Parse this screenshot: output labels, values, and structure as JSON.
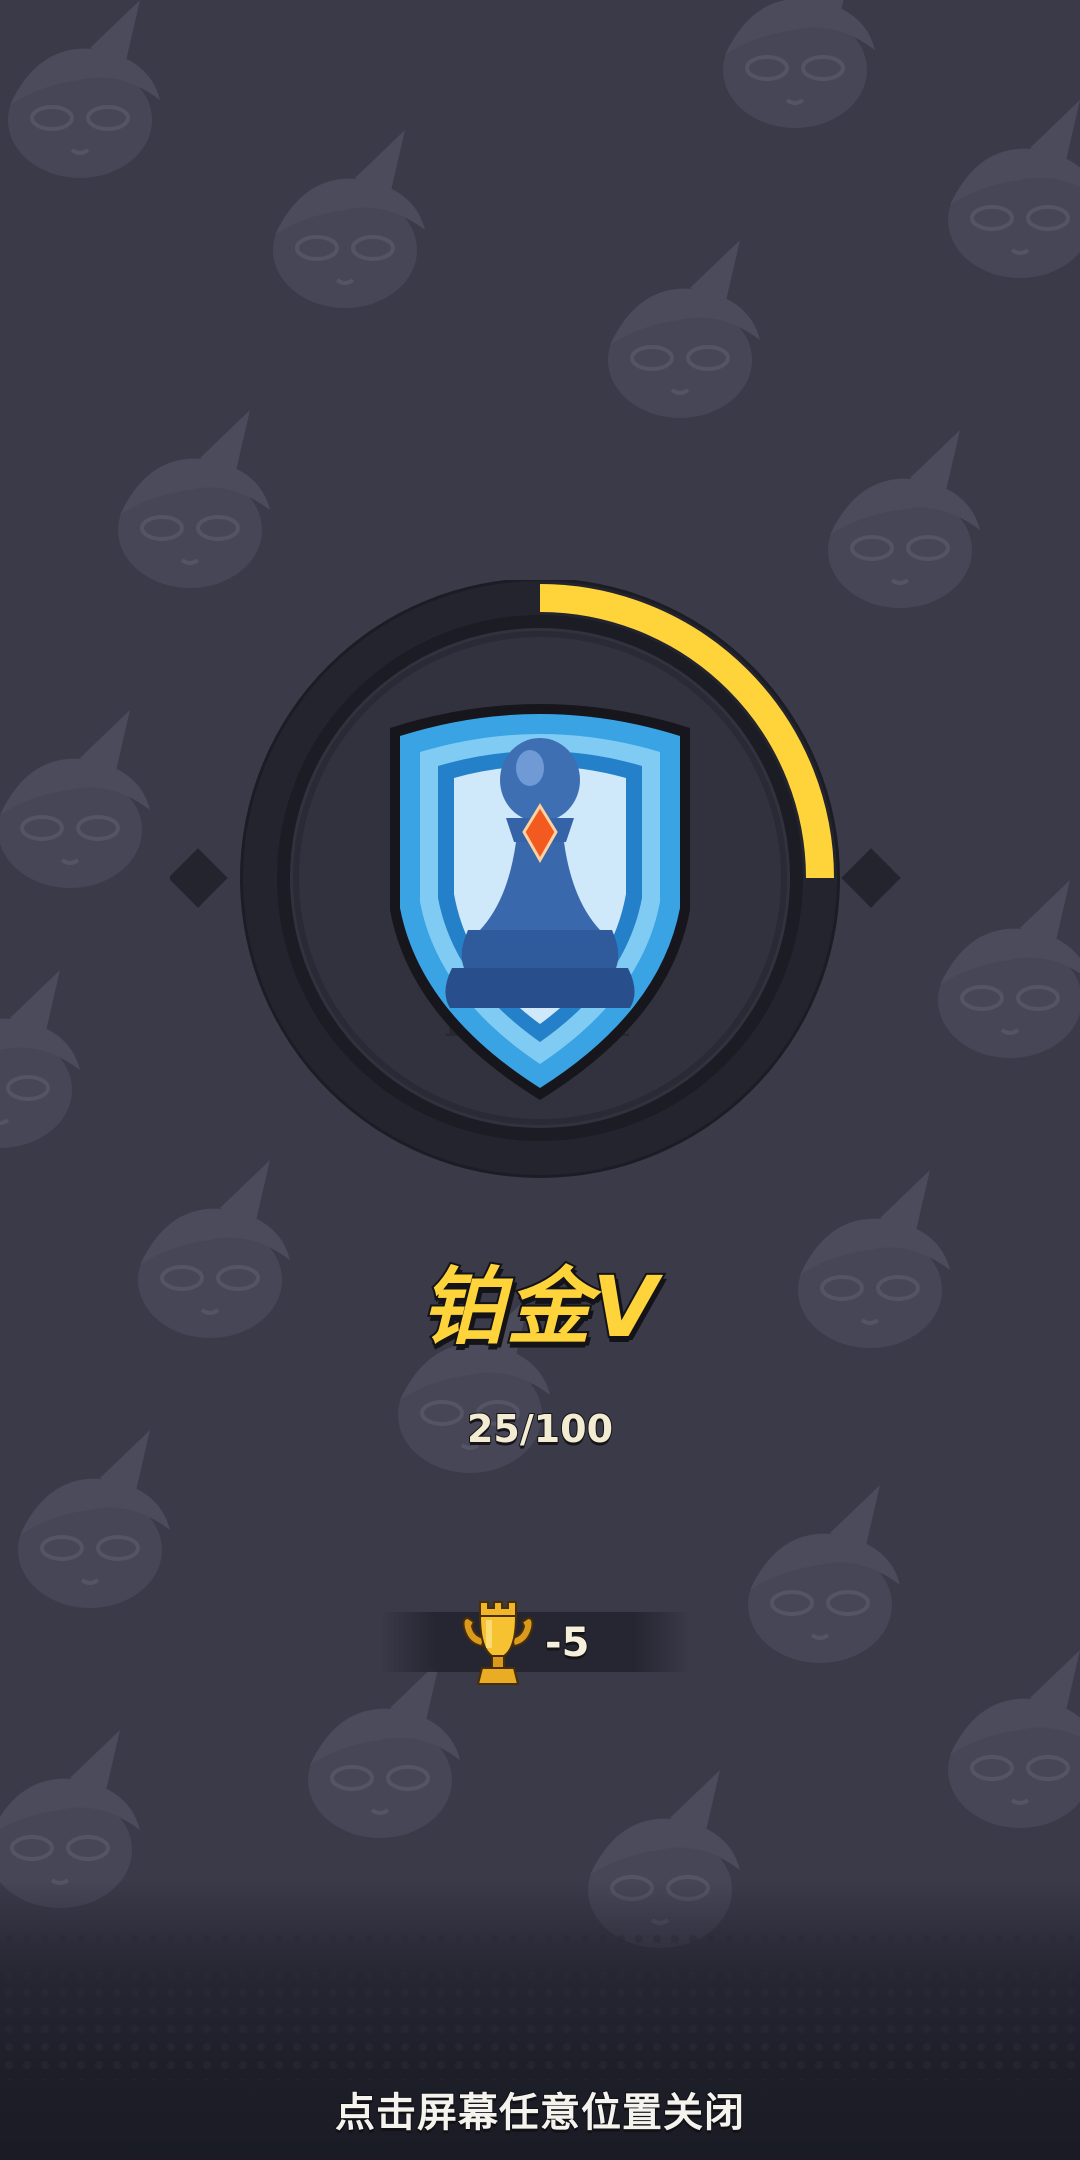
{
  "rank": {
    "name": "铂金V",
    "tier": "platinum",
    "icon": "pawn-shield-emblem",
    "progress_label": "25/100",
    "progress_current": 25,
    "progress_max": 100
  },
  "trophy": {
    "icon": "rook-trophy-icon",
    "change_label": "-5"
  },
  "footer": {
    "close_hint": "点击屏幕任意位置关闭"
  },
  "colors": {
    "background": "#3a3a49",
    "ring_progress": "#ffd43b",
    "ring_track": "#23242e",
    "title_gold": "#ffd43b",
    "shield_blue": "#2f8fd4"
  }
}
